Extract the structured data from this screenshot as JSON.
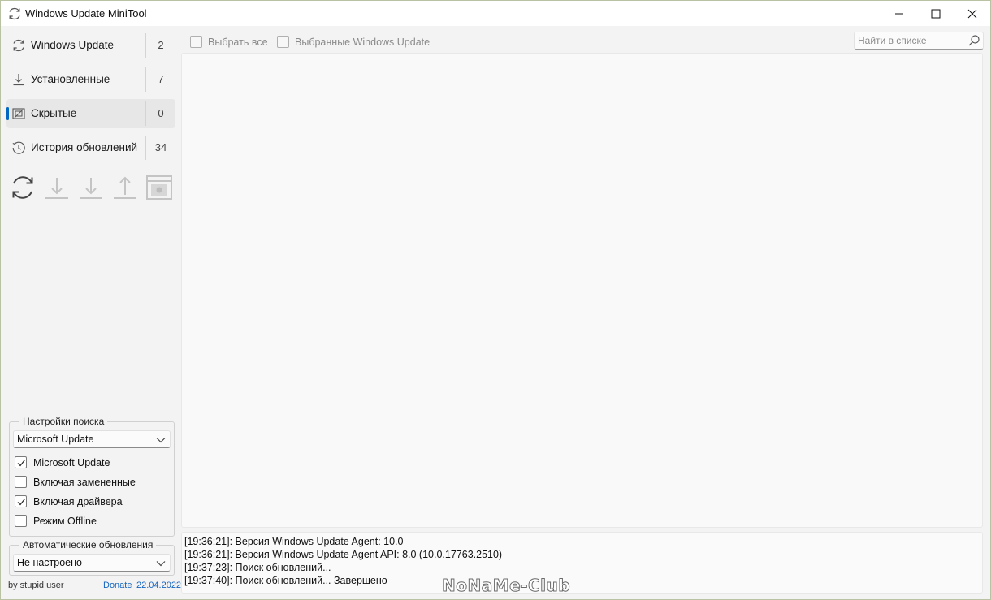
{
  "window": {
    "title": "Windows Update MiniTool"
  },
  "sidebar": {
    "items": [
      {
        "label": "Windows Update",
        "count": "2",
        "icon": "refresh-icon"
      },
      {
        "label": "Установленные",
        "count": "7",
        "icon": "download-icon"
      },
      {
        "label": "Скрытые",
        "count": "0",
        "icon": "hidden-icon",
        "active": true
      },
      {
        "label": "История обновлений",
        "count": "34",
        "icon": "history-icon"
      }
    ],
    "tools": [
      "refresh-icon",
      "download-icon",
      "install-icon",
      "upload-icon",
      "hide-icon"
    ],
    "search_settings": {
      "title": "Настройки поиска",
      "source": "Microsoft Update",
      "options": [
        {
          "label": "Microsoft Update",
          "checked": true
        },
        {
          "label": "Включая замененные",
          "checked": false
        },
        {
          "label": "Включая драйвера",
          "checked": true
        },
        {
          "label": "Режим Offline",
          "checked": false
        }
      ]
    },
    "auto_updates": {
      "title": "Автоматические обновления",
      "value": "Не настроено"
    },
    "footer": {
      "author": "by stupid user",
      "donate": "Donate",
      "date": "22.04.2022"
    }
  },
  "toolbar": {
    "select_all": "Выбрать все",
    "selected_updates": "Выбранные Windows Update",
    "search_placeholder": "Найти в списке"
  },
  "log": {
    "lines": [
      "[19:36:21]: Версия Windows Update Agent: 10.0",
      "[19:36:21]: Версия Windows Update Agent API: 8.0 (10.0.17763.2510)",
      "[19:37:23]: Поиск обновлений...",
      "[19:37:40]: Поиск обновлений... Завершено"
    ]
  },
  "watermark": "NoNaMe-Club",
  "colors": {
    "accent": "#0067c0",
    "link": "#1565c0"
  }
}
